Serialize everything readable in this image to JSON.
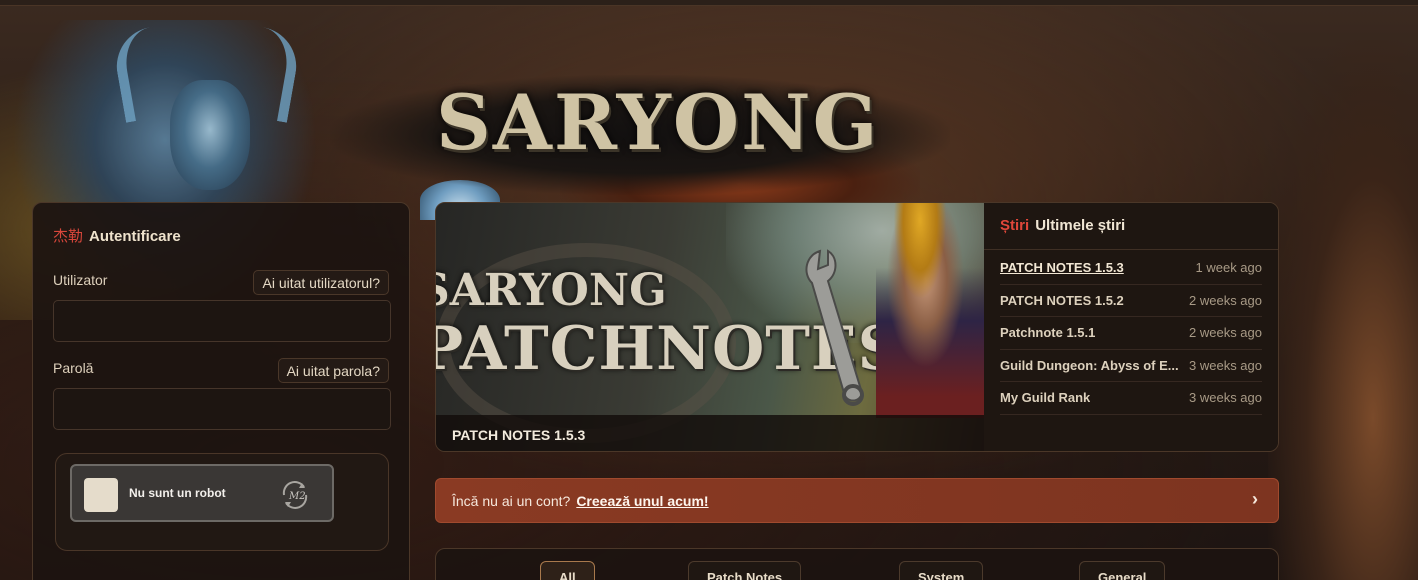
{
  "brand": {
    "logo_text": "SARYONG"
  },
  "auth": {
    "title_glyph": "杰勒",
    "title": "Autentificare",
    "username_label": "Utilizator",
    "forgot_username": "Ai uitat utilizatorul?",
    "password_label": "Parolă",
    "forgot_password": "Ai uitat parola?",
    "username_value": "",
    "password_value": "",
    "captcha_label": "Nu sunt un robot"
  },
  "news": {
    "banner_line1": "SARYONG",
    "banner_line2": "PATCHNOTES",
    "banner_caption": "PATCH NOTES 1.5.3",
    "tag": "Știri",
    "heading": "Ultimele știri",
    "items": [
      {
        "title": "PATCH NOTES 1.5.3",
        "date": "1 week ago"
      },
      {
        "title": "PATCH NOTES 1.5.2",
        "date": "2 weeks ago"
      },
      {
        "title": "Patchnote 1.5.1",
        "date": "2 weeks ago"
      },
      {
        "title": "Guild Dungeon: Abyss of E...",
        "date": "3 weeks ago"
      },
      {
        "title": "My Guild Rank",
        "date": "3 weeks ago"
      }
    ]
  },
  "signup": {
    "text": "Încă nu ai un cont?",
    "link": "Creează unul acum!",
    "arrow": "›"
  },
  "filters": {
    "tabs": [
      {
        "label": "All"
      },
      {
        "label": "Patch Notes"
      },
      {
        "label": "System"
      },
      {
        "label": "General"
      }
    ]
  },
  "colors": {
    "accent_red": "#d9473b",
    "signup_bg": "#8a3a23",
    "panel_bg": "#1c1410",
    "text_light": "#e9dcc8"
  }
}
